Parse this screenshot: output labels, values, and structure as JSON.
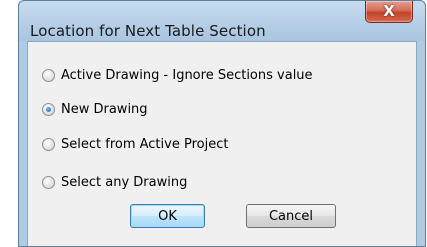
{
  "dialog": {
    "title": "Location for Next Table Section",
    "close_glyph": "X"
  },
  "options": [
    {
      "label": "Active Drawing - Ignore Sections value",
      "selected": false
    },
    {
      "label": "New Drawing",
      "selected": true
    },
    {
      "label": "Select from Active Project",
      "selected": false
    },
    {
      "label": "Select any Drawing",
      "selected": false
    }
  ],
  "buttons": {
    "ok_label": "OK",
    "cancel_label": "Cancel"
  }
}
